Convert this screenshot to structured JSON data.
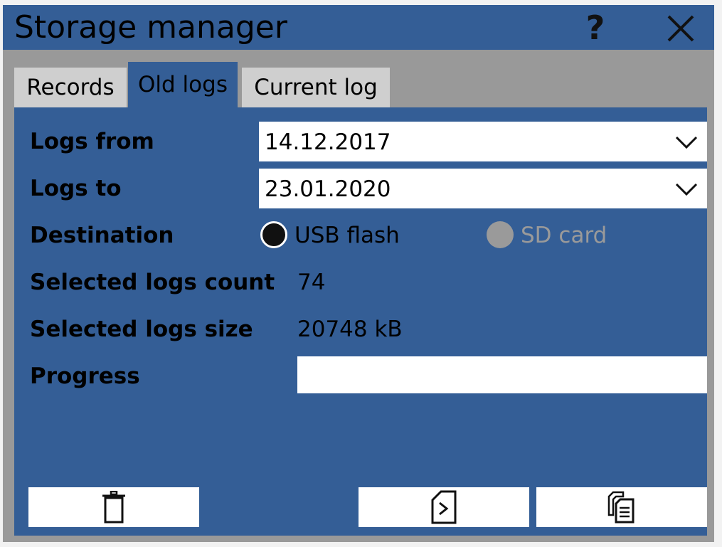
{
  "window": {
    "title": "Storage manager",
    "help_glyph": "?",
    "help_icon": "question-mark-icon",
    "close_icon": "close-x-icon"
  },
  "tabs": [
    {
      "label": "Records",
      "active": false
    },
    {
      "label": "Old logs",
      "active": true
    },
    {
      "label": "Current log",
      "active": false
    }
  ],
  "form": {
    "logs_from": {
      "label": "Logs from",
      "value": "14.12.2017"
    },
    "logs_to": {
      "label": "Logs to",
      "value": "23.01.2020"
    },
    "destination": {
      "label": "Destination",
      "options": [
        {
          "label": "USB flash",
          "selected": true,
          "enabled": true
        },
        {
          "label": "SD card",
          "selected": false,
          "enabled": false
        }
      ]
    },
    "selected_count": {
      "label": "Selected logs count",
      "value": "74"
    },
    "selected_size": {
      "label": "Selected logs size",
      "value": "20748 kB"
    },
    "progress": {
      "label": "Progress",
      "fraction": 0
    }
  },
  "actions": [
    {
      "name": "delete",
      "icon": "trash-icon"
    },
    {
      "name": "export",
      "icon": "export-file-icon"
    },
    {
      "name": "copy",
      "icon": "copy-documents-icon"
    }
  ],
  "colors": {
    "panel": "#345e96",
    "window_bg": "#999999",
    "tab_inactive": "#cfcfcf",
    "radio_selected": "#111111",
    "radio_disabled": "#9a9a9a",
    "disabled_text": "#9a9a9a"
  }
}
